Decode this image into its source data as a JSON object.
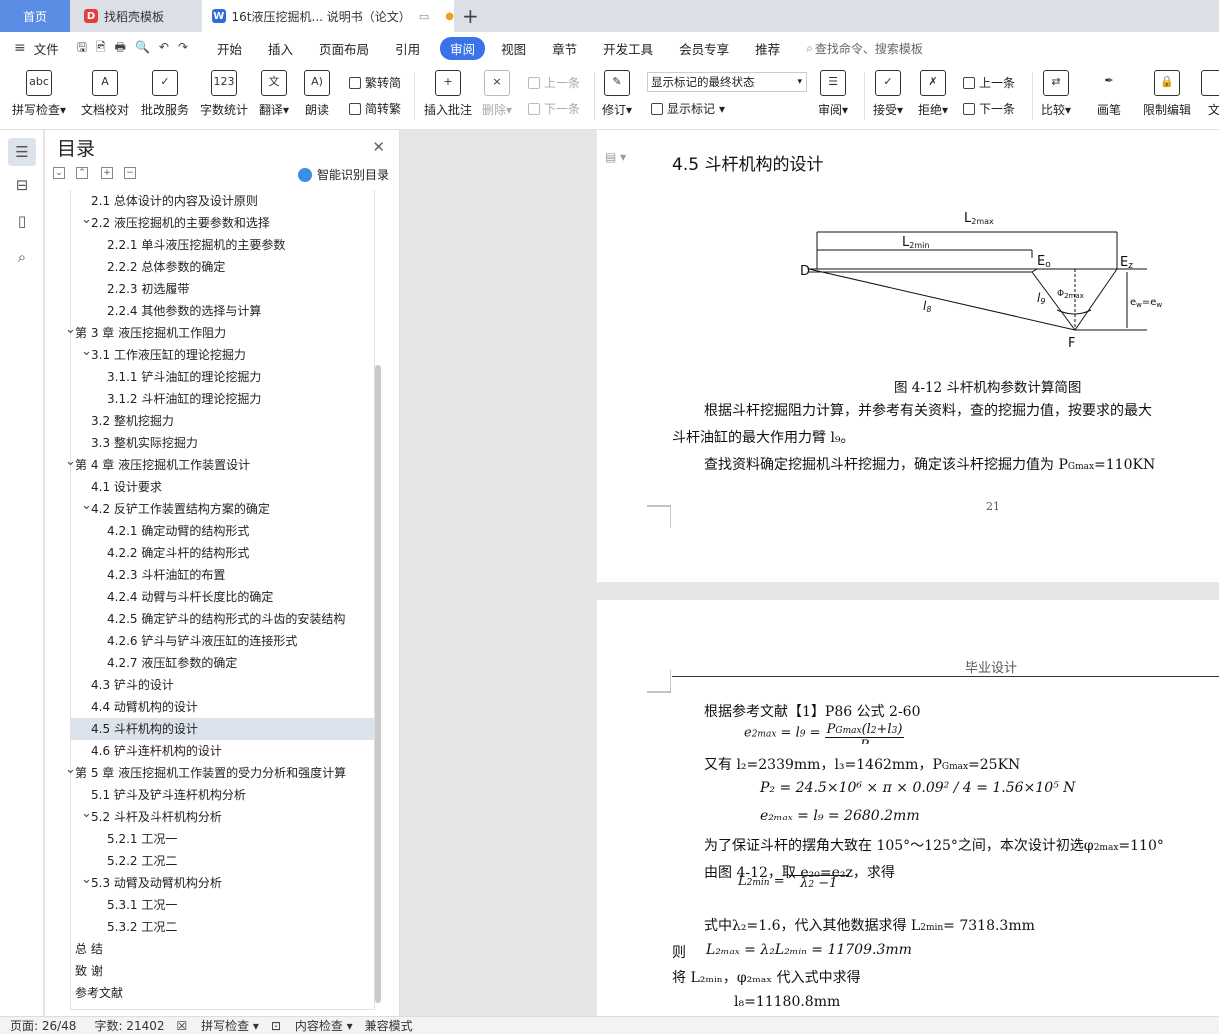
{
  "tabs": [
    {
      "label": "首页"
    },
    {
      "label": "找稻壳模板"
    },
    {
      "label": "16t液压挖掘机... 说明书（论文）"
    }
  ],
  "menu": {
    "file": "文件",
    "items": [
      "开始",
      "插入",
      "页面布局",
      "引用",
      "审阅",
      "视图",
      "章节",
      "开发工具",
      "会员专享",
      "推荐"
    ],
    "active": "审阅",
    "search": "查找命令、搜索模板"
  },
  "ribbon": {
    "spell": "拼写检查",
    "proof": "文档校对",
    "annot": "批改服务",
    "count": "字数统计",
    "translate": "翻译",
    "read": "朗读",
    "trad": "繁转简",
    "simp": "简转繁",
    "insert_comment": "插入批注",
    "delete": "删除",
    "prev_c": "上一条",
    "next_c": "下一条",
    "revise": "修订",
    "show_state": "显示标记的最终状态",
    "show_marks": "显示标记",
    "review": "审阅",
    "accept": "接受",
    "reject": "拒绝",
    "prev": "上一条",
    "next": "下一条",
    "compare": "比较",
    "pen": "画笔",
    "restrict": "限制编辑",
    "doc": "文"
  },
  "toc": {
    "title": "目录",
    "smart": "智能识别目录",
    "items": [
      {
        "label": "2.1  总体设计的内容及设计原则",
        "level": 1,
        "arrow": ""
      },
      {
        "label": "2.2  液压挖掘机的主要参数和选择",
        "level": 1,
        "arrow": "v"
      },
      {
        "label": "2.2.1  单斗液压挖掘机的主要参数",
        "level": 2,
        "arrow": ""
      },
      {
        "label": "2.2.2  总体参数的确定",
        "level": 2,
        "arrow": ""
      },
      {
        "label": "2.2.3 初选履带",
        "level": 2,
        "arrow": ""
      },
      {
        "label": "2.2.4 其他参数的选择与计算",
        "level": 2,
        "arrow": ""
      },
      {
        "label": "第 3 章  液压挖掘机工作阻力",
        "level": 0,
        "arrow": "v"
      },
      {
        "label": "3.1  工作液压缸的理论挖掘力",
        "level": 1,
        "arrow": "v"
      },
      {
        "label": "3.1.1 铲斗油缸的理论挖掘力",
        "level": 2,
        "arrow": ""
      },
      {
        "label": "3.1.2  斗杆油缸的理论挖掘力",
        "level": 2,
        "arrow": ""
      },
      {
        "label": "3.2  整机挖掘力",
        "level": 1,
        "arrow": ""
      },
      {
        "label": "3.3  整机实际挖掘力",
        "level": 1,
        "arrow": ""
      },
      {
        "label": "第 4 章  液压挖掘机工作装置设计",
        "level": 0,
        "arrow": "v"
      },
      {
        "label": "4.1 设计要求",
        "level": 1,
        "arrow": ""
      },
      {
        "label": "4.2 反铲工作装置结构方案的确定",
        "level": 1,
        "arrow": "v"
      },
      {
        "label": "4.2.1 确定动臂的结构形式",
        "level": 2,
        "arrow": ""
      },
      {
        "label": "4.2.2 确定斗杆的结构形式",
        "level": 2,
        "arrow": ""
      },
      {
        "label": "4.2.3 斗杆油缸的布置",
        "level": 2,
        "arrow": ""
      },
      {
        "label": "4.2.4 动臂与斗杆长度比的确定",
        "level": 2,
        "arrow": ""
      },
      {
        "label": "4.2.5 确定铲斗的结构形式的斗齿的安装结构",
        "level": 2,
        "arrow": ""
      },
      {
        "label": "4.2.6 铲斗与铲斗液压缸的连接形式",
        "level": 2,
        "arrow": ""
      },
      {
        "label": "4.2.7 液压缸参数的确定",
        "level": 2,
        "arrow": ""
      },
      {
        "label": "4.3  铲斗的设计",
        "level": 1,
        "arrow": ""
      },
      {
        "label": "4.4 动臂机构的设计",
        "level": 1,
        "arrow": ""
      },
      {
        "label": "4.5 斗杆机构的设计",
        "level": 1,
        "arrow": "",
        "selected": true
      },
      {
        "label": "4.6  铲斗连杆机构的设计",
        "level": 1,
        "arrow": ""
      },
      {
        "label": "第 5 章  液压挖掘机工作装置的受力分析和强度计算",
        "level": 0,
        "arrow": "v"
      },
      {
        "label": "5.1 铲斗及铲斗连杆机构分析",
        "level": 1,
        "arrow": ""
      },
      {
        "label": "5.2 斗杆及斗杆机构分析",
        "level": 1,
        "arrow": "v"
      },
      {
        "label": "5.2.1 工况一",
        "level": 2,
        "arrow": ""
      },
      {
        "label": "5.2.2 工况二",
        "level": 2,
        "arrow": ""
      },
      {
        "label": "5.3 动臂及动臂机构分析",
        "level": 1,
        "arrow": "v"
      },
      {
        "label": "5.3.1 工况一",
        "level": 2,
        "arrow": ""
      },
      {
        "label": "5.3.2 工况二",
        "level": 2,
        "arrow": ""
      },
      {
        "label": "总    结",
        "level": 0,
        "arrow": ""
      },
      {
        "label": "致    谢",
        "level": 0,
        "arrow": ""
      },
      {
        "label": "参考文献",
        "level": 0,
        "arrow": ""
      }
    ]
  },
  "page1": {
    "heading": "4.5 斗杆机构的设计",
    "fig": {
      "L2max": "L",
      "L2max_sub": "2max",
      "L2min": "L",
      "L2min_sub": "2min",
      "D": "D",
      "E0": "E",
      "E0_sub": "o",
      "Ez": "E",
      "Ez_sub": "z",
      "F": "F",
      "l8": "l",
      "l8_sub": "8",
      "l9": "l",
      "l9_sub": "9",
      "phi": "Φ",
      "phi_sub": "2max",
      "ew": "e",
      "ew_sub": "w",
      "eq": "=e",
      "ez_sub": "w"
    },
    "caption": "图 4-12 斗杆机构参数计算简图",
    "p1": "根据斗杆挖掘阻力计算，并参考有关资料，查的挖掘力值，按要求的最大",
    "p2": "斗杆油缸的最大作用力臂 l₉。",
    "p3": "查找资料确定挖掘机斗杆挖掘力，确定该斗杆挖掘力值为 P",
    "p3_sub": "Gmax",
    "p3_end": "=110KN",
    "pageno": "21"
  },
  "page2": {
    "header": "毕业设计",
    "l1": "根据参考文献【1】P86 公式 2-60",
    "l2": "又有 l₂=2339mm，l₃=1462mm，P",
    "l2_sub": "Gmax",
    "l2_end": "=25KN",
    "l3": "P₂ = 24.5×10⁶ × π × 0.09² / 4 = 1.56×10⁵ N",
    "l4": "e₂ₘₐₓ = l₉ = 2680.2mm",
    "l5": "为了保证斗杆的摆角大致在 105°～125°之间，本次设计初选φ",
    "l5_sub": "2max",
    "l5_end": "=110°",
    "l6": "由图 4-12，取 e₂₀=e₂z，求得",
    "l7": "式中λ₂=1.6，代入其他数据求得 L",
    "l7_sub": "2min",
    "l7_end": "= 7318.3mm",
    "l8": "则",
    "l8b": "L₂ₘₐₓ = λ₂L₂ₘᵢₙ = 11709.3mm",
    "l9": "将 L₂ₘᵢₙ，φ₂ₘₐₓ 代入式中求得",
    "l10": "l₈=11180.8mm"
  },
  "status": {
    "page": "页面: 26/48",
    "words": "字数: 21402",
    "spell": "拼写检查",
    "content": "内容检查",
    "mode": "兼容模式"
  }
}
